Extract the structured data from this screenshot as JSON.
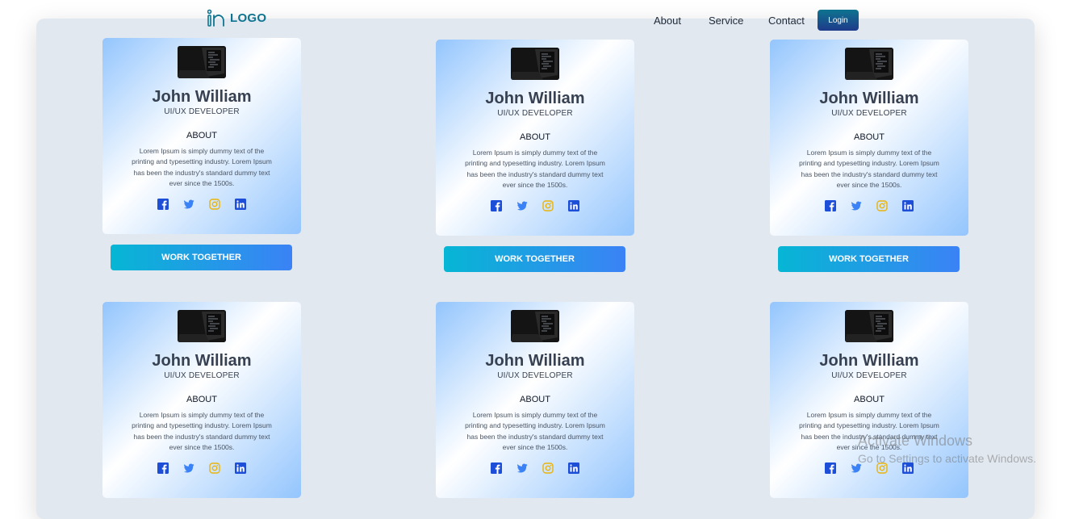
{
  "nav": {
    "logo_text": "LOGO",
    "links": [
      "About",
      "Service",
      "Contact"
    ],
    "login_label": "Login"
  },
  "cards": [
    {
      "name": "John William",
      "role": "UI/UX DEVELOPER",
      "about_title": "ABOUT",
      "about_text": "Lorem Ipsum is simply dummy text of the printing and typesetting industry. Lorem Ipsum has been the industry's standard dummy text ever since the 1500s.",
      "button_label": "WORK TOGETHER"
    },
    {
      "name": "John William",
      "role": "UI/UX DEVELOPER",
      "about_title": "ABOUT",
      "about_text": "Lorem Ipsum is simply dummy text of the printing and typesetting industry. Lorem Ipsum has been the industry's standard dummy text ever since the 1500s.",
      "button_label": "WORK TOGETHER"
    },
    {
      "name": "John William",
      "role": "UI/UX DEVELOPER",
      "about_title": "ABOUT",
      "about_text": "Lorem Ipsum is simply dummy text of the printing and typesetting industry. Lorem Ipsum has been the industry's standard dummy text ever since the 1500s.",
      "button_label": "WORK TOGETHER"
    },
    {
      "name": "John William",
      "role": "UI/UX DEVELOPER",
      "about_title": "ABOUT",
      "about_text": "Lorem Ipsum is simply dummy text of the printing and typesetting industry. Lorem Ipsum has been the industry's standard dummy text ever since the 1500s."
    },
    {
      "name": "John William",
      "role": "UI/UX DEVELOPER",
      "about_title": "ABOUT",
      "about_text": "Lorem Ipsum is simply dummy text of the printing and typesetting industry. Lorem Ipsum has been the industry's standard dummy text ever since the 1500s."
    },
    {
      "name": "John William",
      "role": "UI/UX DEVELOPER",
      "about_title": "ABOUT",
      "about_text": "Lorem Ipsum is simply dummy text of the printing and typesetting industry. Lorem Ipsum has been the industry's standard dummy text ever since the 1500s."
    }
  ],
  "social_icons": [
    "facebook-icon",
    "twitter-icon",
    "instagram-icon",
    "linkedin-icon"
  ],
  "colors": {
    "panel_bg": "#e2e8f0",
    "logo": "#0e7490",
    "facebook": "#1d4ed8",
    "twitter": "#3b82f6",
    "instagram": "#eab308",
    "linkedin": "#1d4ed8",
    "button_gradient_start": "#06b6d4",
    "button_gradient_end": "#3b82f6"
  },
  "watermark": {
    "line1": "Activate Windows",
    "line2": "Go to Settings to activate Windows."
  }
}
